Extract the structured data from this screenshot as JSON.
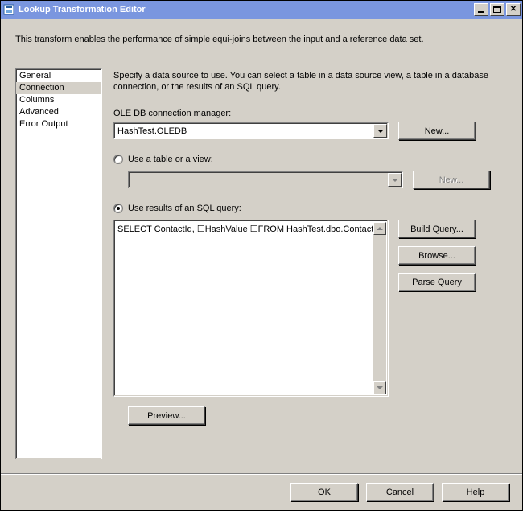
{
  "window": {
    "title": "Lookup Transformation Editor"
  },
  "description": "This transform enables the performance of simple equi-joins between the input and a reference data set.",
  "sidebar": {
    "items": [
      {
        "label": "General"
      },
      {
        "label": "Connection"
      },
      {
        "label": "Columns"
      },
      {
        "label": "Advanced"
      },
      {
        "label": "Error Output"
      }
    ],
    "selected_index": 1
  },
  "content": {
    "instructions": "Specify a data source to use. You can select a table in a data source view, a table in a database connection, or the results of an SQL query.",
    "oledb_label_pre": "O",
    "oledb_label_ul": "L",
    "oledb_label_post": "E DB connection manager:",
    "oledb_value": "HashTest.OLEDB",
    "new_button": "New...",
    "radio_table_label": "Use a table or a view:",
    "radio_sql_label": "Use results of an SQL query:",
    "sql_text": "SELECT ContactId, ☐HashValue ☐FROM HashTest.dbo.Contact",
    "build_query": "Build Query...",
    "browse": "Browse...",
    "parse_query": "Parse Query",
    "preview": "Preview..."
  },
  "buttons": {
    "ok": "OK",
    "cancel": "Cancel",
    "help": "Help"
  }
}
